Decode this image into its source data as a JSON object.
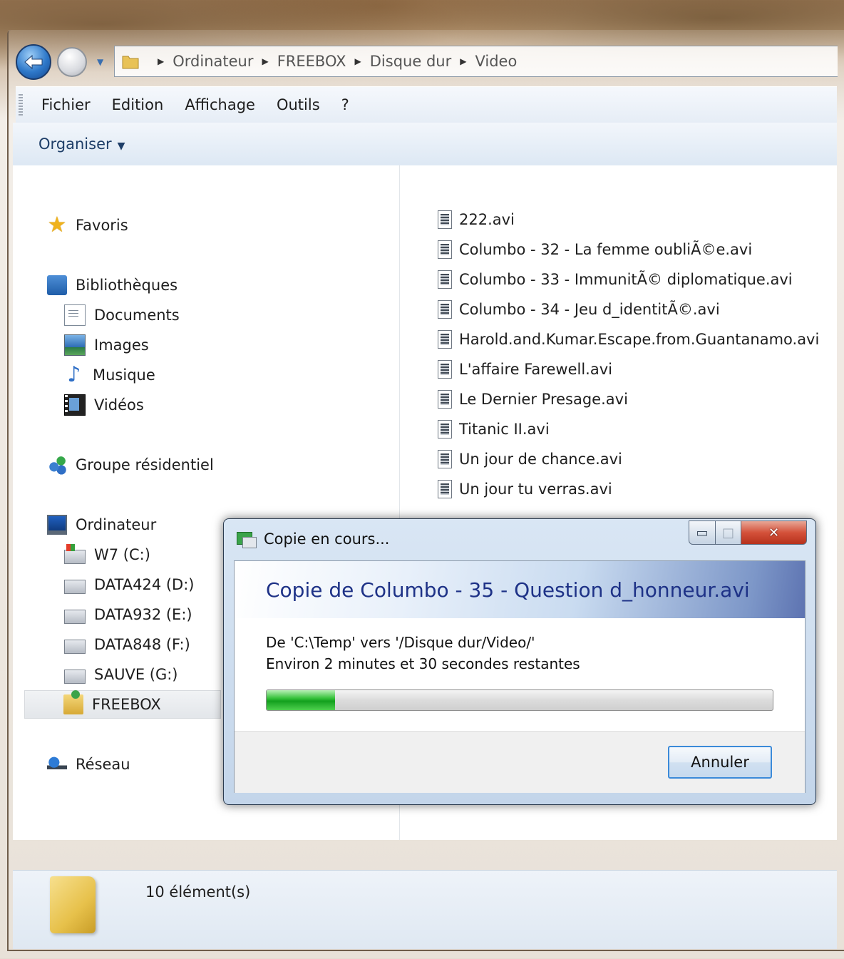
{
  "address": {
    "breadcrumbs": [
      "Ordinateur",
      "FREEBOX",
      "Disque dur",
      "Video"
    ]
  },
  "menu": {
    "items": [
      "Fichier",
      "Edition",
      "Affichage",
      "Outils",
      "?"
    ]
  },
  "commandbar": {
    "organise_label": "Organiser"
  },
  "nav": {
    "favorites": "Favoris",
    "libraries": "Bibliothèques",
    "documents": "Documents",
    "images": "Images",
    "music": "Musique",
    "videos": "Vidéos",
    "homegroup": "Groupe résidentiel",
    "computer": "Ordinateur",
    "drives": [
      "W7 (C:)",
      "DATA424 (D:)",
      "DATA932 (E:)",
      "DATA848 (F:)",
      "SAUVE (G:)"
    ],
    "freebox": "FREEBOX",
    "network": "Réseau"
  },
  "files": [
    "222.avi",
    "Columbo - 32 - La femme oubliÃ©e.avi",
    "Columbo - 33 - ImmunitÃ© diplomatique.avi",
    "Columbo - 34 - Jeu d_identitÃ©.avi",
    "Harold.and.Kumar.Escape.from.Guantanamo.avi",
    "L'affaire Farewell.avi",
    "Le Dernier Presage.avi",
    "Titanic II.avi",
    "Un jour de chance.avi",
    "Un jour tu verras.avi"
  ],
  "status": {
    "count_text": "10 élément(s)"
  },
  "dialog": {
    "title": "Copie en cours...",
    "heading": "Copie de Columbo - 35 - Question d_honneur.avi",
    "from_to": "De 'C:\\Temp' vers '/Disque dur/Video/'",
    "remaining": "Environ 2 minutes et 30 secondes restantes",
    "progress_fraction": 0.135,
    "cancel_label": "Annuler"
  }
}
